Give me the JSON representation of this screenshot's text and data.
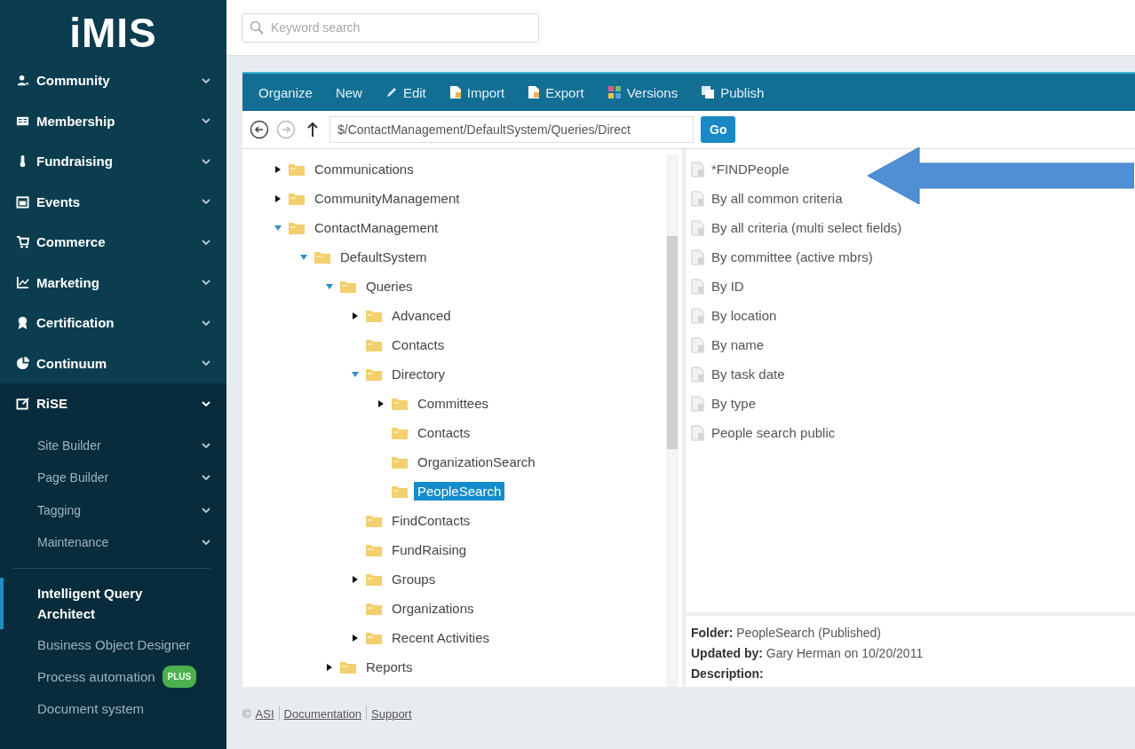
{
  "sidebar": {
    "logo": "iMIS",
    "items": [
      {
        "label": "Community",
        "expanded": false
      },
      {
        "label": "Membership",
        "expanded": false
      },
      {
        "label": "Fundraising",
        "expanded": false
      },
      {
        "label": "Events",
        "expanded": false
      },
      {
        "label": "Commerce",
        "expanded": false
      },
      {
        "label": "Marketing",
        "expanded": false
      },
      {
        "label": "Certification",
        "expanded": false
      },
      {
        "label": "Continuum",
        "expanded": false
      },
      {
        "label": "RiSE",
        "expanded": true
      }
    ],
    "subitems": [
      {
        "label": "Site Builder"
      },
      {
        "label": "Page Builder"
      },
      {
        "label": "Tagging"
      },
      {
        "label": "Maintenance"
      }
    ],
    "links": [
      {
        "label": "Intelligent Query Architect",
        "selected": true
      },
      {
        "label": "Business Object Designer",
        "selected": false
      },
      {
        "label": "Process automation",
        "selected": false,
        "badge": "PLUS"
      },
      {
        "label": "Document system",
        "selected": false
      }
    ]
  },
  "search": {
    "placeholder": "Keyword search"
  },
  "toolbar": [
    {
      "label": "Organize",
      "kind": "text"
    },
    {
      "label": "New",
      "kind": "text"
    },
    {
      "label": "Edit",
      "kind": "edit"
    },
    {
      "label": "Import",
      "kind": "import"
    },
    {
      "label": "Export",
      "kind": "export"
    },
    {
      "label": "Versions",
      "kind": "versions"
    },
    {
      "label": "Publish",
      "kind": "publish"
    }
  ],
  "nav": {
    "back_disabled": false,
    "forward_disabled": true,
    "path": "$/ContactManagement/DefaultSystem/Queries/Direct",
    "go": "Go"
  },
  "tree": [
    {
      "label": "Communications",
      "expanded": false,
      "selected": false
    },
    {
      "label": "CommunityManagement",
      "expanded": false,
      "selected": false
    },
    {
      "label": "ContactManagement",
      "expanded": true,
      "selected": false,
      "children": [
        {
          "label": "DefaultSystem",
          "expanded": true,
          "selected": false,
          "children": [
            {
              "label": "Queries",
              "expanded": true,
              "selected": false,
              "children": [
                {
                  "label": "Advanced",
                  "expanded": false,
                  "selected": false
                },
                {
                  "label": "Contacts",
                  "selected": false
                },
                {
                  "label": "Directory",
                  "expanded": true,
                  "selected": false,
                  "children": [
                    {
                      "label": "Committees",
                      "expanded": false,
                      "selected": false
                    },
                    {
                      "label": "Contacts",
                      "selected": false
                    },
                    {
                      "label": "OrganizationSearch",
                      "selected": false
                    },
                    {
                      "label": "PeopleSearch",
                      "selected": true
                    }
                  ]
                },
                {
                  "label": "FindContacts",
                  "selected": false
                },
                {
                  "label": "FundRaising",
                  "selected": false
                },
                {
                  "label": "Groups",
                  "expanded": false,
                  "selected": false
                },
                {
                  "label": "Organizations",
                  "selected": false
                },
                {
                  "label": "Recent Activities",
                  "expanded": false,
                  "selected": false
                }
              ]
            },
            {
              "label": "Reports",
              "expanded": false,
              "selected": false
            }
          ]
        }
      ]
    }
  ],
  "documents": [
    {
      "label": "*FINDPeople"
    },
    {
      "label": "By all common criteria"
    },
    {
      "label": "By all criteria (multi select fields)"
    },
    {
      "label": "By committee (active mbrs)"
    },
    {
      "label": "By ID"
    },
    {
      "label": "By location"
    },
    {
      "label": "By name"
    },
    {
      "label": "By task date"
    },
    {
      "label": "By type"
    },
    {
      "label": "People search public"
    }
  ],
  "details": [
    "**Folder:** PeopleSearch (Published)",
    "**Updated by:** Gary Herman on 10/20/2011",
    "**Description:**"
  ],
  "footer": {
    "copyright": "©",
    "links": [
      "ASI",
      "Documentation",
      "Support"
    ]
  }
}
